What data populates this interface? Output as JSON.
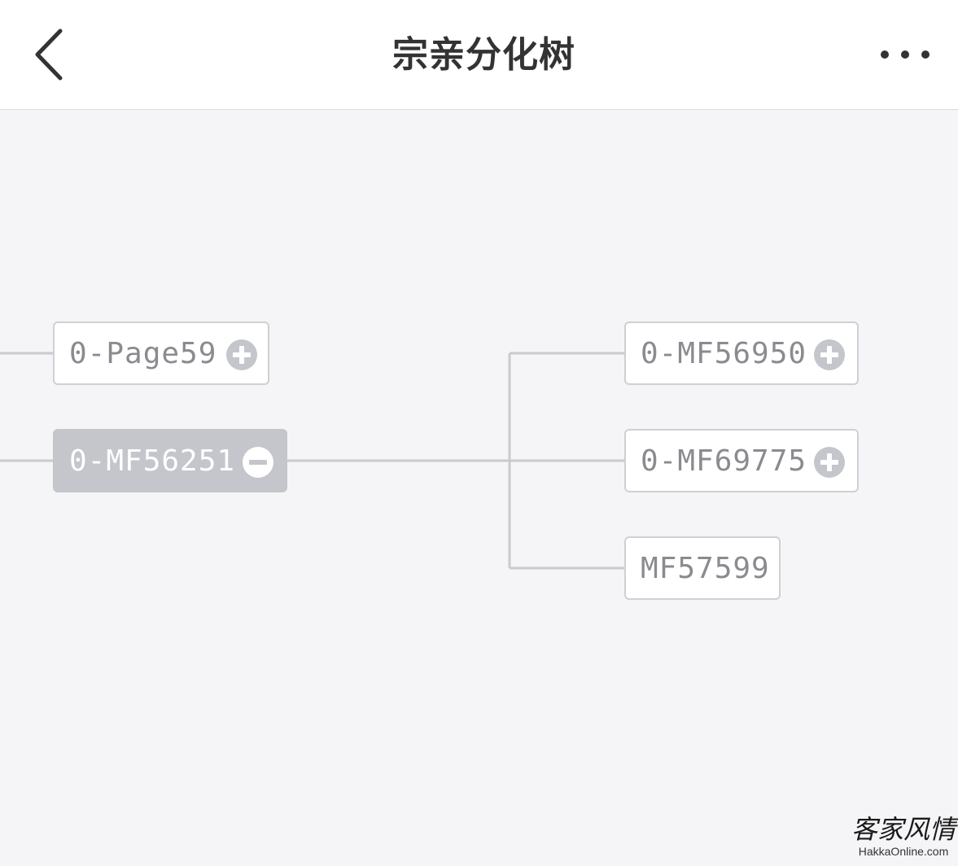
{
  "header": {
    "title": "宗亲分化树",
    "back_icon": "chevron-left-icon",
    "more_icon": "more-dots-icon"
  },
  "tree": {
    "nodes": [
      {
        "id": "page59",
        "label": "0-Page59",
        "state": "collapsed",
        "icon": "plus-circle-icon"
      },
      {
        "id": "mf56251",
        "label": "0-MF56251",
        "state": "expanded",
        "icon": "minus-circle-icon"
      },
      {
        "id": "mf56950",
        "label": "0-MF56950",
        "state": "collapsed",
        "icon": "plus-circle-icon"
      },
      {
        "id": "mf69775",
        "label": "0-MF69775",
        "state": "collapsed",
        "icon": "plus-circle-icon"
      },
      {
        "id": "mf57599",
        "label": "MF57599",
        "state": "leaf"
      }
    ],
    "edges": [
      {
        "from": "mf56251",
        "to": "mf56950"
      },
      {
        "from": "mf56251",
        "to": "mf69775"
      },
      {
        "from": "mf56251",
        "to": "mf57599"
      }
    ],
    "colors": {
      "line": "#c9cacf",
      "node_border": "#cfd0d4",
      "node_text": "#8a8b90",
      "active_fill": "#c4c6cc",
      "icon_fill": "#c4c6cc",
      "canvas_bg": "#f5f5f7"
    }
  },
  "watermark": {
    "name_cn": "客家风情",
    "site": "HakkaOnline.com"
  }
}
